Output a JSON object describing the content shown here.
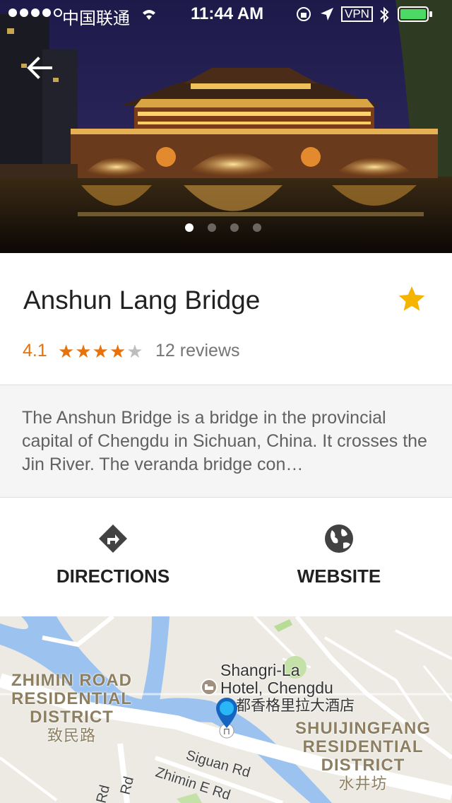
{
  "status_bar": {
    "carrier": "中国联通",
    "time": "11:44 AM",
    "vpn": "VPN"
  },
  "gallery": {
    "page_count": 4,
    "current_page": 1
  },
  "place": {
    "name": "Anshun Lang Bridge",
    "rating": "4.1",
    "stars_filled": 4,
    "stars_total": 5,
    "reviews": "12 reviews",
    "description": "The Anshun Bridge is a bridge in the provincial capital of Chengdu in Sichuan, China. It crosses the Jin River. The veranda bridge con…",
    "saved": true
  },
  "actions": {
    "directions": "DIRECTIONS",
    "website": "WEBSITE"
  },
  "map": {
    "district_left_1": "ZHIMIN ROAD",
    "district_left_2": "RESIDENTIAL",
    "district_left_3": "DISTRICT",
    "district_left_cn": "致民路",
    "hotel_1": "Shangri-La",
    "hotel_2": "Hotel, Chengdu",
    "hotel_cn": "都香格里拉大酒店",
    "district_right_1": "SHUIJINGFANG",
    "district_right_2": "RESIDENTIAL",
    "district_right_3": "DISTRICT",
    "district_right_cn": "水井坊",
    "road_1": "Siguan Rd",
    "road_2": "Zhimin E Rd",
    "road_3": "Rd",
    "road_4": "Rd"
  },
  "colors": {
    "accent": "#e8710a",
    "star_fav": "#f4b400",
    "pin": "#1e88e5"
  }
}
